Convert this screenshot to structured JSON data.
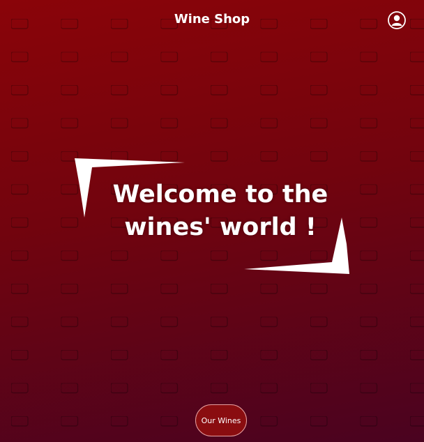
{
  "header": {
    "title": "Wine Shop",
    "profile_icon": "user-profile-icon"
  },
  "hero": {
    "line1": "Welcome to the",
    "line2": "wines' world !",
    "decoration_icon": "corner-brackets-icon"
  },
  "cta": {
    "label": "Our Wines"
  },
  "colors": {
    "background_top": "#8a0409",
    "background_bottom": "#4a0320",
    "button_fill": "#8a0d10",
    "text": "#ffffff"
  }
}
